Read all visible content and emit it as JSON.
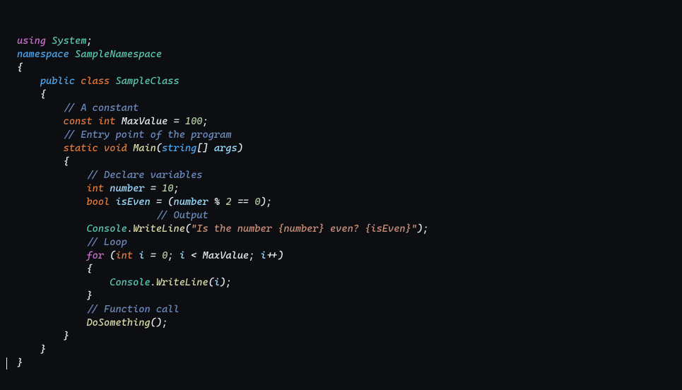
{
  "code": {
    "l1": {
      "using": "using",
      "system": "System",
      "semi": ";"
    },
    "l2": {
      "namespace": "namespace",
      "name": "SampleNamespace"
    },
    "l3": {
      "brace": "{"
    },
    "l4": {
      "public": "public",
      "class": "class",
      "name": "SampleClass"
    },
    "l5": {
      "brace": "{"
    },
    "l6": {
      "comment": "// A constant"
    },
    "l7": {
      "const": "const",
      "int": "int",
      "name": "MaxValue",
      "eq": "=",
      "val": "100",
      "semi": ";"
    },
    "l8": {
      "comment": "// Entry point of the program"
    },
    "l9": {
      "static": "static",
      "void": "void",
      "main": "Main",
      "lp": "(",
      "string": "string",
      "br": "[]",
      "args": "args",
      "rp": ")"
    },
    "l10": {
      "brace": "{"
    },
    "l11": {
      "comment": "// Declare variables"
    },
    "l12": {
      "int": "int",
      "name": "number",
      "eq": "=",
      "val": "10",
      "semi": ";"
    },
    "l13": {
      "bool": "bool",
      "name": "isEven",
      "eq": "=",
      "lp": "(",
      "num": "number",
      "mod": "%",
      "two": "2",
      "eqeq": "==",
      "zero": "0",
      "rp": ")",
      "semi": ";"
    },
    "l14": {
      "comment": "// Output"
    },
    "l15": {
      "console": "Console",
      "dot": ".",
      "wl": "WriteLine",
      "lp": "(",
      "str": "\"Is the number {number} even? {isEven}\"",
      "rp": ")",
      "semi": ";"
    },
    "l16": {
      "comment": "// Loop"
    },
    "l17": {
      "for": "for",
      "lp": "(",
      "int": "int",
      "i": "i",
      "eq": "=",
      "zero": "0",
      "semi1": ";",
      "i2": "i",
      "lt": "<",
      "max": "MaxValue",
      "semi2": ";",
      "i3": "i",
      "pp": "++",
      "rp": ")"
    },
    "l18": {
      "brace": "{"
    },
    "l19": {
      "console": "Console",
      "dot": ".",
      "wl": "WriteLine",
      "lp": "(",
      "i": "i",
      "rp": ")",
      "semi": ";"
    },
    "l20": {
      "brace": "}"
    },
    "l21": {
      "comment": "// Function call"
    },
    "l22": {
      "fn": "DoSomething",
      "lp": "(",
      "rp": ")",
      "semi": ";"
    },
    "l23": {
      "brace": "}"
    },
    "l24": {
      "brace": "}"
    },
    "l25": {
      "brace": "}"
    }
  },
  "colors": {
    "background": "#0d0e12",
    "keyword_purple": "#c371c6",
    "keyword_blue": "#4ba7ef",
    "keyword_orange": "#e2783c",
    "classname": "#59c7b2",
    "method": "#dcdcaa",
    "identifier": "#9cdcfe",
    "string": "#ce9178",
    "number": "#b5cea8",
    "comment": "#6c8bbf",
    "default": "#e6edf3"
  }
}
